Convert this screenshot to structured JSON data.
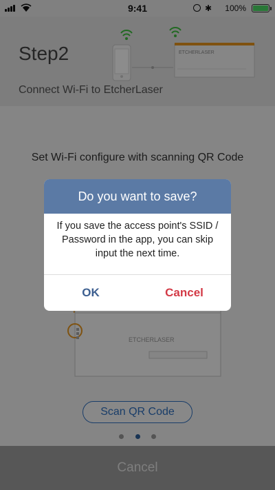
{
  "status_bar": {
    "time": "9:41",
    "battery_percent": "100%"
  },
  "header": {
    "step_title": "Step2",
    "subtitle": "Connect Wi-Fi to EtcherLaser"
  },
  "main": {
    "instruction": "Set Wi-Fi configure with scanning QR Code",
    "device_brand": "ETCHERLASER",
    "scan_button": "Scan QR Code",
    "page_indicator": {
      "count": 3,
      "active_index": 1
    }
  },
  "footer": {
    "cancel_label": "Cancel"
  },
  "dialog": {
    "title": "Do you want to save?",
    "message": "If you save the access point's SSID / Password in the app, you can skip input the next time.",
    "ok_label": "OK",
    "cancel_label": "Cancel"
  },
  "colors": {
    "accent": "#2f6fbf",
    "dialog_header": "#5b7aa5",
    "cancel_red": "#d33a46",
    "device_orange": "#e8961e",
    "wifi_green": "#3fbf3f",
    "battery_green": "#4cd964"
  }
}
